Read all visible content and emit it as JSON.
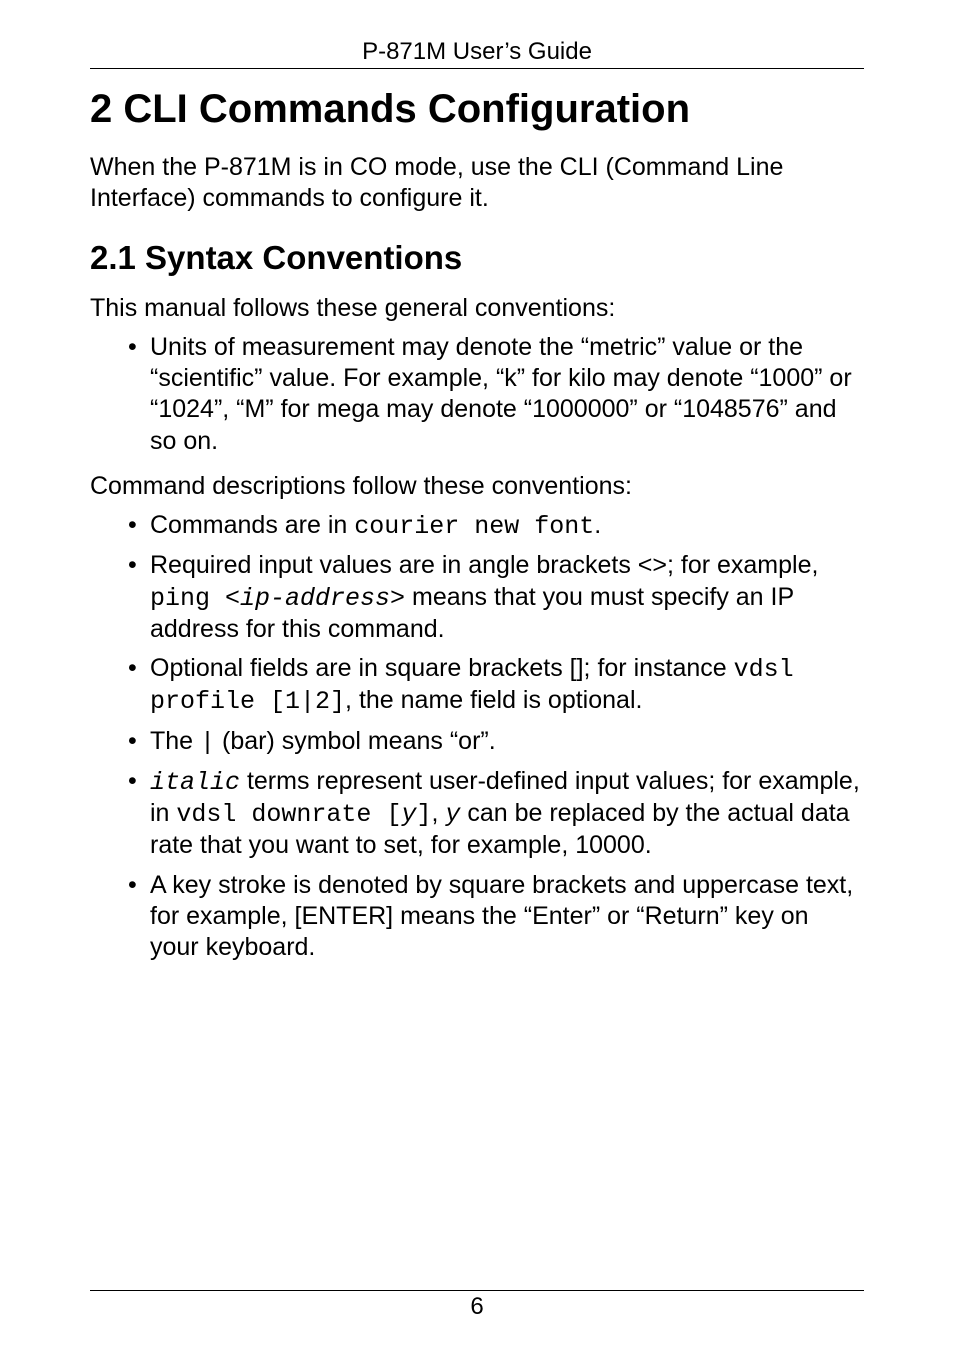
{
  "header": {
    "running_head": "P-871M User’s Guide"
  },
  "chapter": {
    "title": "2 CLI Commands Configuration",
    "intro": "When the P-871M is in CO mode, use the CLI (Command Line Interface) commands to configure it."
  },
  "section": {
    "title": "2.1 Syntax Conventions",
    "para1": "This manual follows these general conventions:",
    "general_items": [
      "Units of measurement may denote the “metric” value or the “scientific” value. For example, “k” for kilo may denote “1000” or “1024”, “M” for mega may denote “1000000” or “1048576” and so on."
    ],
    "para2": "Command descriptions follow these conventions:",
    "cmd_items": {
      "i0": {
        "prefix": "Commands are in ",
        "mono": "courier new font",
        "suffix": "."
      },
      "i1": {
        "prefix": "Required input values are in angle brackets <>; for example, ",
        "mono1": "ping <",
        "monoital": "ip-address",
        "mono2": ">",
        "suffix": " means that you must specify an IP address for this command."
      },
      "i2": {
        "prefix": "Optional fields are in square brackets []; for instance ",
        "mono": "vdsl profile [1|2]",
        "suffix": ", the name field is optional."
      },
      "i3": {
        "prefix": "The ",
        "mono": "|",
        "suffix": " (bar) symbol means “or”."
      },
      "i4": {
        "monoital1": "italic",
        "mid1": " terms represent user-defined input values; for example, in ",
        "mono1": "vdsl downrate [",
        "monoital2": "y",
        "mono2": "]",
        "mid2": ", ",
        "monoital3": "y",
        "suffix": " can be replaced by the actual data rate that you want to set, for example, 10000."
      },
      "i5": {
        "text": "A key stroke is denoted by square brackets and uppercase text, for example, [ENTER] means the “Enter” or “Return” key on your keyboard."
      }
    }
  },
  "footer": {
    "page_number": "6"
  }
}
